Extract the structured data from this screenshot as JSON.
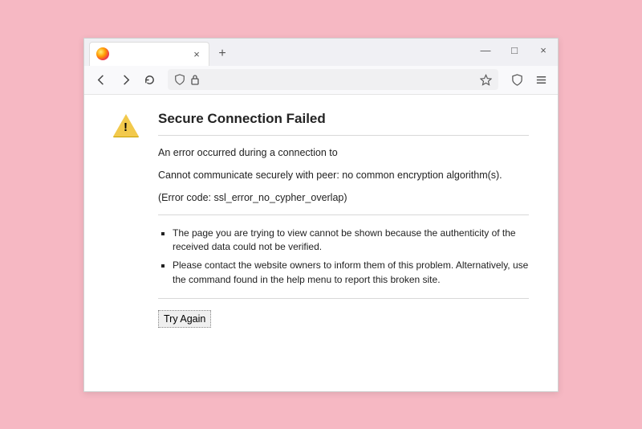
{
  "window": {
    "tab_title": "",
    "icons": {
      "close_tab": "×",
      "new_tab": "+",
      "minimize": "—",
      "maximize": "□",
      "close_window": "×"
    }
  },
  "nav": {
    "back": "back-icon",
    "forward": "forward-icon",
    "reload": "reload-icon",
    "shield": "shield-icon",
    "lock": "lock-icon",
    "bookmark": "star-icon",
    "protections": "shield-outline-icon",
    "menu": "menu-icon"
  },
  "error": {
    "title": "Secure Connection Failed",
    "line1": "An error occurred during a connection to",
    "line2": "Cannot communicate securely with peer: no common encryption algorithm(s).",
    "code_line": "(Error code: ssl_error_no_cypher_overlap)",
    "bullets": [
      "The page you are trying to view cannot be shown because the authenticity of the received data could not be verified.",
      "Please contact the website owners to inform them of this problem. Alternatively, use the command found in the help menu to report this broken site."
    ],
    "try_again_label": "Try Again"
  }
}
